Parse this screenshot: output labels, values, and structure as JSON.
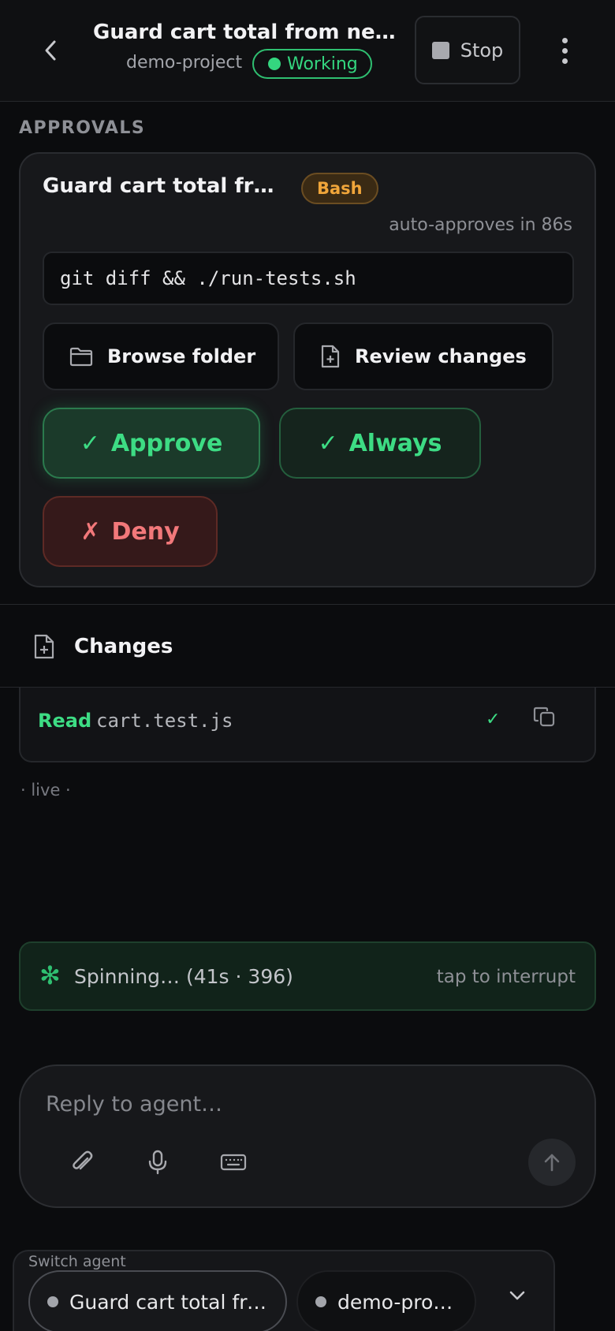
{
  "header": {
    "back_label": "Back",
    "title": "Guard cart total from negative values",
    "project": "demo-project",
    "status": "Working",
    "stop_label": "Stop",
    "colors": {
      "status": "#34d67f",
      "background": "#0f1012"
    }
  },
  "approvals": {
    "section_label": "APPROVALS",
    "item": {
      "title": "Guard cart total from negative values",
      "tool": "Bash",
      "auto_approve": "auto-approves in 86s",
      "command": "git diff && ./run-tests.sh",
      "browse_label": "Browse folder",
      "review_label": "Review changes",
      "approve_label": "Approve",
      "always_label": "Always",
      "deny_label": "Deny",
      "approve_symbol": "✓",
      "deny_symbol": "✗"
    },
    "colors": {
      "approve": "#3ddc84",
      "deny": "#f2787a",
      "tool_badge": "#f0a53a"
    }
  },
  "changes": {
    "label": "Changes"
  },
  "activity": {
    "entries": [
      {
        "verb": "Read",
        "target": "cart.test.js",
        "check": "✓"
      }
    ],
    "live_label": "· live ·"
  },
  "spinner": {
    "icon": "✻",
    "text": "Spinning… (41s · 396)",
    "hint": "tap to interrupt"
  },
  "composer": {
    "placeholder": "Reply to agent…",
    "value": "",
    "icons": [
      "paperclip-icon",
      "microphone-icon",
      "keyboard-icon",
      "arrow-up-icon"
    ]
  },
  "switcher": {
    "label": "Switch agent",
    "agents": [
      {
        "name": "Guard cart total from negative values"
      },
      {
        "name": "demo-project"
      }
    ]
  }
}
